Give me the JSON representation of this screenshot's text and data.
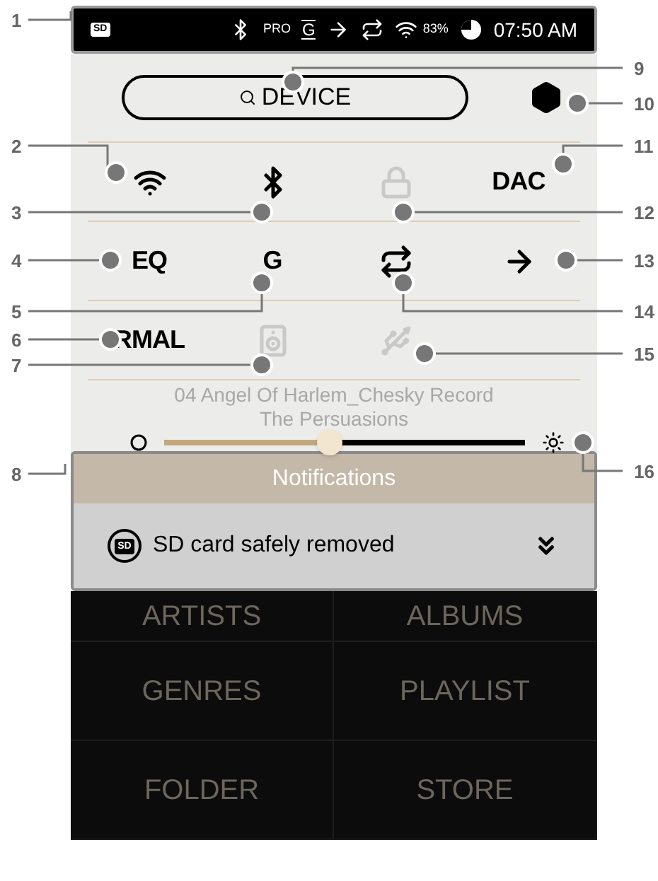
{
  "status_bar": {
    "sd": "SD",
    "pro": "PRO",
    "gain": "G",
    "battery": "83%",
    "time": "07:50 AM"
  },
  "device_button": {
    "label": "DEVICE"
  },
  "controls": [
    [
      {
        "kind": "wifi",
        "disabled": false
      },
      {
        "kind": "bluetooth",
        "disabled": false
      },
      {
        "kind": "lock",
        "disabled": true
      },
      {
        "kind": "dac",
        "label": "DAC",
        "disabled": false
      }
    ],
    [
      {
        "kind": "eq",
        "label": "EQ",
        "disabled": false
      },
      {
        "kind": "gain",
        "label": "G",
        "disabled": false
      },
      {
        "kind": "repeat",
        "disabled": false
      },
      {
        "kind": "arrow",
        "disabled": false
      }
    ],
    [
      {
        "kind": "mode",
        "label": "RMAL",
        "disabled": false
      },
      {
        "kind": "speaker",
        "disabled": true
      },
      {
        "kind": "usb",
        "disabled": true
      }
    ]
  ],
  "now_playing": {
    "title": "04 Angel Of Harlem_Chesky Record",
    "artist": "The Persuasions"
  },
  "brightness": {
    "level": 0.46
  },
  "notifications": {
    "title": "Notifications",
    "items": [
      {
        "icon_label": "SD",
        "text": "SD card safely removed"
      }
    ]
  },
  "menu": [
    [
      "ARTISTS",
      "ALBUMS"
    ],
    [
      "GENRES",
      "PLAYLIST"
    ],
    [
      "FOLDER",
      "STORE"
    ]
  ],
  "callouts": [
    "1",
    "2",
    "3",
    "4",
    "5",
    "6",
    "7",
    "8",
    "9",
    "10",
    "11",
    "12",
    "13",
    "14",
    "15",
    "16"
  ]
}
